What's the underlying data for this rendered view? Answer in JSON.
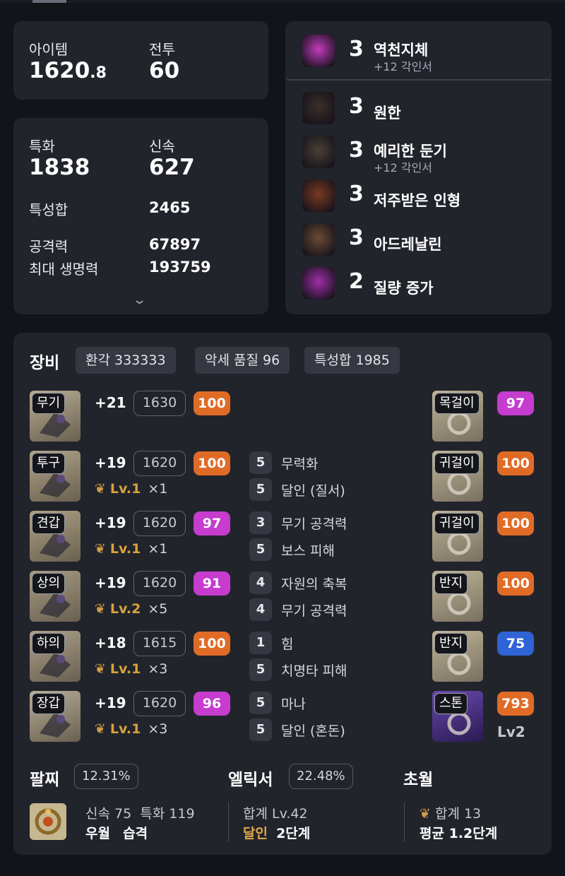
{
  "stats_top": {
    "item_label": "아이템",
    "item_value_main": "1620",
    "item_value_frac": ".8",
    "combat_label": "전투",
    "combat_value": "60"
  },
  "stats": {
    "spec_label": "특화",
    "spec_value": "1838",
    "swift_label": "신속",
    "swift_value": "627",
    "trait_sum_label": "특성합",
    "trait_sum_value": "2465",
    "attack_label": "공격력",
    "attack_value": "67897",
    "hp_label": "최대 생명력",
    "hp_value": "193759",
    "expand_icon": "chevron-down"
  },
  "engravings": [
    {
      "level": "3",
      "name": "역천지체",
      "sub": "+12 각인서",
      "color": "#c33bbd"
    },
    {
      "level": "3",
      "name": "원한",
      "sub": "",
      "color": "#3b2f2a"
    },
    {
      "level": "3",
      "name": "예리한 둔기",
      "sub": "+12 각인서",
      "color": "#4a4036"
    },
    {
      "level": "3",
      "name": "저주받은 인형",
      "sub": "",
      "color": "#7a3a22"
    },
    {
      "level": "3",
      "name": "아드레날린",
      "sub": "",
      "color": "#6b4b33"
    },
    {
      "level": "2",
      "name": "질량 증가",
      "sub": "",
      "color": "#a02fa8"
    }
  ],
  "equipment": {
    "title": "장비",
    "tags": [
      "환각 333333",
      "악세 품질 96",
      "특성합 1985"
    ],
    "armor": [
      {
        "slot": "무기",
        "plus": "+21",
        "ilvl": "1630",
        "quality": "100",
        "qcolor": "orange",
        "lv": "",
        "mult": "",
        "effects": []
      },
      {
        "slot": "투구",
        "plus": "+19",
        "ilvl": "1620",
        "quality": "100",
        "qcolor": "orange",
        "lv": "Lv.1",
        "mult": "×1",
        "effects": [
          {
            "n": "5",
            "t": "무력화"
          },
          {
            "n": "5",
            "t": "달인 (질서)"
          }
        ]
      },
      {
        "slot": "견갑",
        "plus": "+19",
        "ilvl": "1620",
        "quality": "97",
        "qcolor": "purple",
        "lv": "Lv.1",
        "mult": "×1",
        "effects": [
          {
            "n": "3",
            "t": "무기 공격력"
          },
          {
            "n": "5",
            "t": "보스 피해"
          }
        ]
      },
      {
        "slot": "상의",
        "plus": "+19",
        "ilvl": "1620",
        "quality": "91",
        "qcolor": "purple",
        "lv": "Lv.2",
        "mult": "×5",
        "effects": [
          {
            "n": "4",
            "t": "자원의 축복"
          },
          {
            "n": "4",
            "t": "무기 공격력"
          }
        ]
      },
      {
        "slot": "하의",
        "plus": "+18",
        "ilvl": "1615",
        "quality": "100",
        "qcolor": "orange",
        "lv": "Lv.1",
        "mult": "×3",
        "effects": [
          {
            "n": "1",
            "t": "힘"
          },
          {
            "n": "5",
            "t": "치명타 피해"
          }
        ]
      },
      {
        "slot": "장갑",
        "plus": "+19",
        "ilvl": "1620",
        "quality": "96",
        "qcolor": "purple",
        "lv": "Lv.1",
        "mult": "×3",
        "effects": [
          {
            "n": "5",
            "t": "마나"
          },
          {
            "n": "5",
            "t": "달인 (혼돈)"
          }
        ]
      }
    ],
    "accessories": [
      {
        "slot": "목걸이",
        "quality": "97",
        "qcolor": "purple"
      },
      {
        "slot": "귀걸이",
        "quality": "100",
        "qcolor": "orange"
      },
      {
        "slot": "귀걸이",
        "quality": "100",
        "qcolor": "orange"
      },
      {
        "slot": "반지",
        "quality": "100",
        "qcolor": "orange"
      },
      {
        "slot": "반지",
        "quality": "75",
        "qcolor": "blue"
      },
      {
        "slot": "스톤",
        "quality": "793",
        "qcolor": "orange",
        "extra": "Lv2"
      }
    ]
  },
  "bracelet": {
    "title": "팔찌",
    "percent": "12.31%",
    "line1_a": "신속 75",
    "line1_b": "특화 119",
    "line2_a": "우월",
    "line2_b": "습격"
  },
  "elixir": {
    "title": "엘릭서",
    "percent": "22.48%",
    "line1": "합계 Lv.42",
    "line2_a": "달인",
    "line2_b": "2단계"
  },
  "transcend": {
    "title": "초월",
    "line1": "합계 13",
    "line2": "평균 1.2단계"
  },
  "colors": {
    "orange": "#e06b26",
    "purple": "#c53ccf",
    "blue": "#2f63d6",
    "gold": "#d7a33a"
  }
}
